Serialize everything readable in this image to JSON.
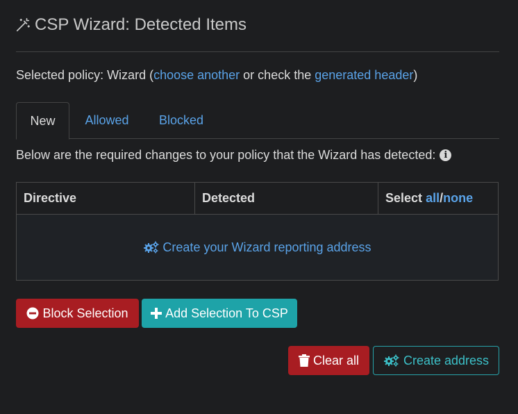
{
  "header": {
    "title": "CSP Wizard: Detected Items",
    "icon": "magic-wand-icon"
  },
  "policy": {
    "prefix": "Selected policy: Wizard (",
    "choose_link": "choose another",
    "middle": " or check the ",
    "header_link": "generated header",
    "suffix": ")"
  },
  "tabs": [
    {
      "label": "New",
      "active": true
    },
    {
      "label": "Allowed",
      "active": false
    },
    {
      "label": "Blocked",
      "active": false
    }
  ],
  "description": "Below are the required changes to your policy that the Wizard has detected:",
  "table": {
    "columns": {
      "directive": "Directive",
      "detected": "Detected",
      "select_prefix": "Select ",
      "select_all": "all",
      "select_sep": "/",
      "select_none": "none"
    },
    "empty_action": "Create your Wizard reporting address"
  },
  "buttons": {
    "block_selection": "Block Selection",
    "add_selection": "Add Selection To CSP",
    "clear_all": "Clear all",
    "create_address": "Create address"
  },
  "colors": {
    "background": "#1d1e20",
    "link": "#5aa3e8",
    "danger": "#a81d22",
    "info": "#1ea3a8"
  }
}
